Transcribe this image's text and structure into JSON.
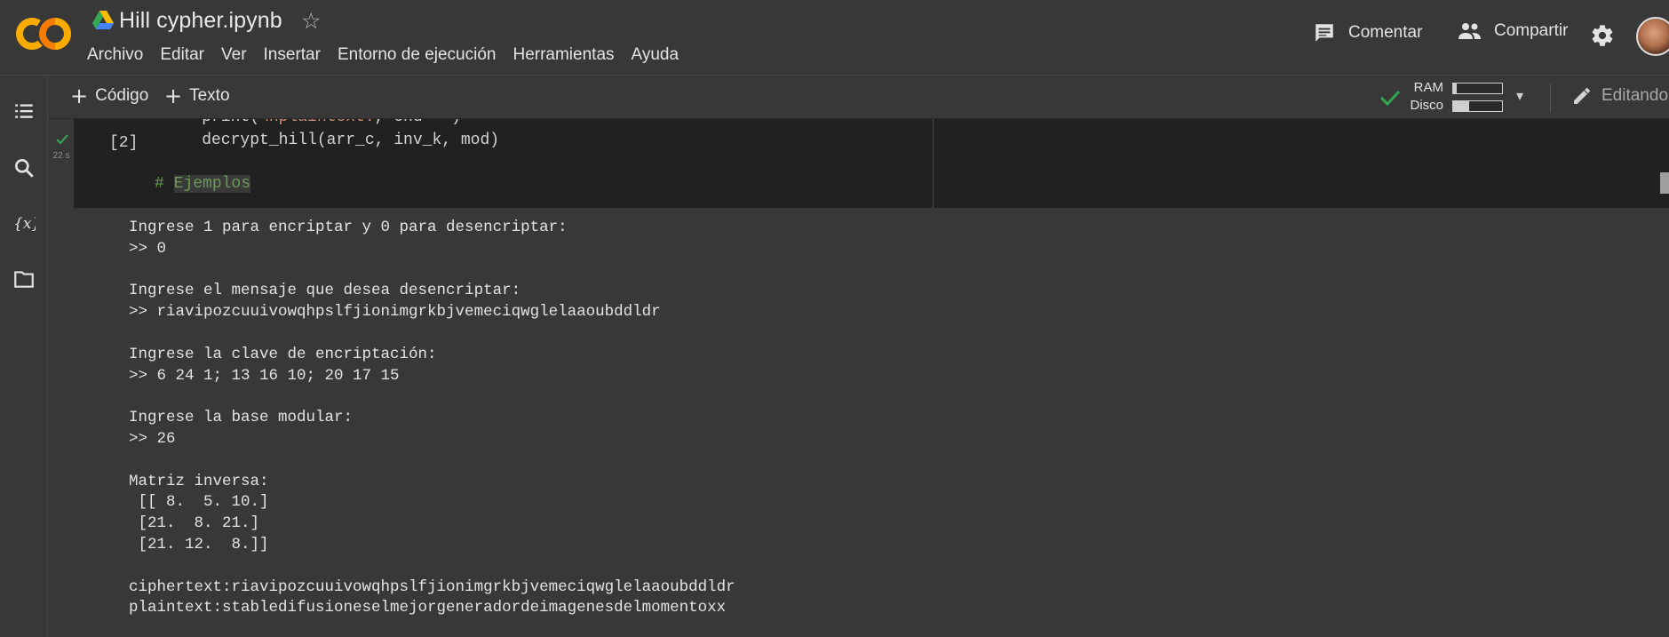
{
  "header": {
    "title": "Hill cypher.ipynb",
    "menu": [
      "Archivo",
      "Editar",
      "Ver",
      "Insertar",
      "Entorno de ejecución",
      "Herramientas",
      "Ayuda"
    ],
    "comment_label": "Comentar",
    "share_label": "Compartir",
    "logo_text": "CO"
  },
  "toolbar": {
    "add_code_label": "Código",
    "add_text_label": "Texto",
    "ram_label": "RAM",
    "disk_label": "Disco",
    "ram_usage": 0.08,
    "disk_usage": 0.32,
    "editing_label": "Editando"
  },
  "cell": {
    "exec_count": "[2]",
    "run_time": "22 s",
    "code_line_0_a": "    print(",
    "code_line_0_b": "\\nplaintext:",
    "code_line_0_c": ", end=",
    "code_line_0_d": "''",
    "code_line_0_e": ")",
    "code_line_1": "    decrypt_hill(arr_c, inv_k, mod)",
    "comment_prefix": "# ",
    "comment_word": "Ejemplos"
  },
  "output": {
    "lines": [
      "Ingrese 1 para encriptar y 0 para desencriptar:",
      ">> 0",
      "",
      "Ingrese el mensaje que desea desencriptar:",
      ">> riavipozcuuivowqhpslfjionimgrkbjvemeciqwglelaaoubddldr",
      "",
      "Ingrese la clave de encriptación:",
      ">> 6 24 1; 13 16 10; 20 17 15",
      "",
      "Ingrese la base modular:",
      ">> 26",
      "",
      "Matriz inversa:",
      " [[ 8.  5. 10.]",
      " [21.  8. 21.]",
      " [21. 12.  8.]]",
      "",
      "ciphertext:riavipozcuuivowqhpslfjionimgrkbjvemeciqwglelaaoubddldr",
      "plaintext:stabledifusioneselmejorgeneradordeimagenesdelmomentoxx"
    ]
  },
  "colors": {
    "background": "#383838",
    "code_bg": "#212121",
    "accent_orange": "#f9ab00",
    "success_green": "#34a853",
    "comment_green": "#6a9955"
  }
}
